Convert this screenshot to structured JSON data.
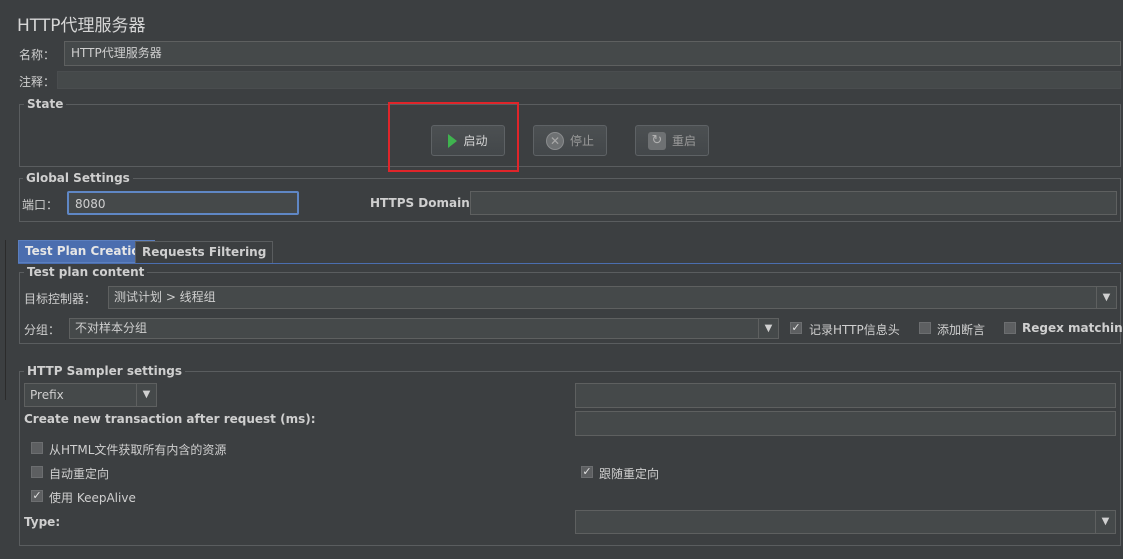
{
  "title": "HTTP代理服务器",
  "name": {
    "label": "名称：",
    "value": "HTTP代理服务器"
  },
  "comment": {
    "label": "注释：",
    "value": ""
  },
  "state": {
    "legend": "State",
    "start_label": "启动",
    "stop_label": "停止",
    "restart_label": "重启"
  },
  "global": {
    "legend": "Global Settings",
    "port_label": "端口：",
    "port_value": "8080",
    "https_label": "HTTPS Domains:",
    "https_value": ""
  },
  "tabs": [
    {
      "label": "Test Plan Creation",
      "active": true
    },
    {
      "label": "Requests Filtering",
      "active": false
    }
  ],
  "test_plan": {
    "legend": "Test plan content",
    "target_label": "目标控制器：",
    "target_value": "测试计划 > 线程组",
    "group_label": "分组：",
    "group_value": "不对样本分组",
    "record_headers": {
      "label": "记录HTTP信息头",
      "checked": true
    },
    "add_assertions": {
      "label": "添加断言",
      "checked": false
    },
    "regex_matching": {
      "label": "Regex matching",
      "checked": false
    }
  },
  "sampler": {
    "legend": "HTTP Sampler settings",
    "prefix_value": "Prefix",
    "prefix_text": "",
    "transaction_label": "Create new transaction after request (ms):",
    "transaction_value": "",
    "retrieve_resources": {
      "label": "从HTML文件获取所有内含的资源",
      "checked": false
    },
    "auto_redirect": {
      "label": "自动重定向",
      "checked": false
    },
    "follow_redirects": {
      "label": "跟随重定向",
      "checked": true
    },
    "keepalive": {
      "label": "使用 KeepAlive",
      "checked": true
    },
    "type_label": "Type:",
    "type_value": ""
  },
  "colors": {
    "background": "#3c3f41",
    "field": "#45494a",
    "active_tab": "#4b6eaf",
    "highlight_box": "#e0252a",
    "focus_border": "#5f87c5",
    "play_icon": "#3fb34f"
  }
}
